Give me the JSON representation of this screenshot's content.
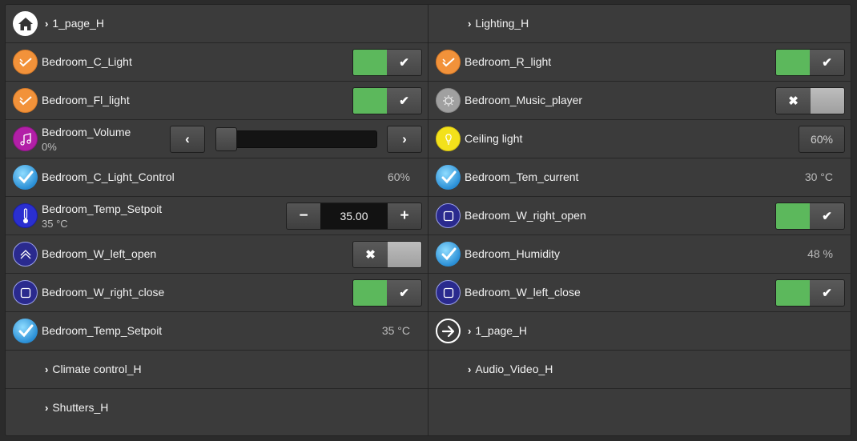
{
  "left": {
    "header_link": "1_page_H",
    "bedroom_c_light": {
      "label": "Bedroom_C_Light",
      "state": "on"
    },
    "bedroom_fl_light": {
      "label": "Bedroom_Fl_light",
      "state": "on"
    },
    "bedroom_volume": {
      "label": "Bedroom_Volume",
      "value": "0%",
      "level": 0
    },
    "bedroom_c_light_control": {
      "label": "Bedroom_C_Light_Control",
      "value": "60%"
    },
    "bedroom_temp_setpoit": {
      "label": "Bedroom_Temp_Setpoit",
      "sub": "35 °C",
      "stepper_value": "35.00"
    },
    "bedroom_w_left_open": {
      "label": "Bedroom_W_left_open",
      "state": "off"
    },
    "bedroom_w_right_close": {
      "label": "Bedroom_W_right_close",
      "state": "on"
    },
    "bedroom_temp_setpoit_2": {
      "label": "Bedroom_Temp_Setpoit",
      "value": "35 °C"
    },
    "climate_link": "Climate control_H",
    "shutters_link": "Shutters_H"
  },
  "right": {
    "header_link": "Lighting_H",
    "bedroom_r_light": {
      "label": "Bedroom_R_light",
      "state": "on"
    },
    "bedroom_music_player": {
      "label": "Bedroom_Music_player",
      "state": "off"
    },
    "ceiling_light": {
      "label": "Ceiling light",
      "value": "60%"
    },
    "bedroom_tem_current": {
      "label": "Bedroom_Tem_current",
      "value": "30 °C"
    },
    "bedroom_w_right_open": {
      "label": "Bedroom_W_right_open",
      "state": "on"
    },
    "bedroom_humidity": {
      "label": "Bedroom_Humidity",
      "value": "48 %"
    },
    "bedroom_w_left_close": {
      "label": "Bedroom_W_left_close",
      "state": "on"
    },
    "page_link": "1_page_H",
    "audio_video_link": "Audio_Video_H"
  },
  "glyphs": {
    "chevron": "›",
    "check": "✔",
    "cross": "✖",
    "minus": "−",
    "plus": "+",
    "prev": "‹",
    "next": "›"
  },
  "colors": {
    "panel": "#3b3b3b",
    "toggle_on": "#5cb85c",
    "orange": "#f2923a",
    "purple": "#b21fa7",
    "yellow": "#f3e11b",
    "navy": "#2a2a8e"
  }
}
